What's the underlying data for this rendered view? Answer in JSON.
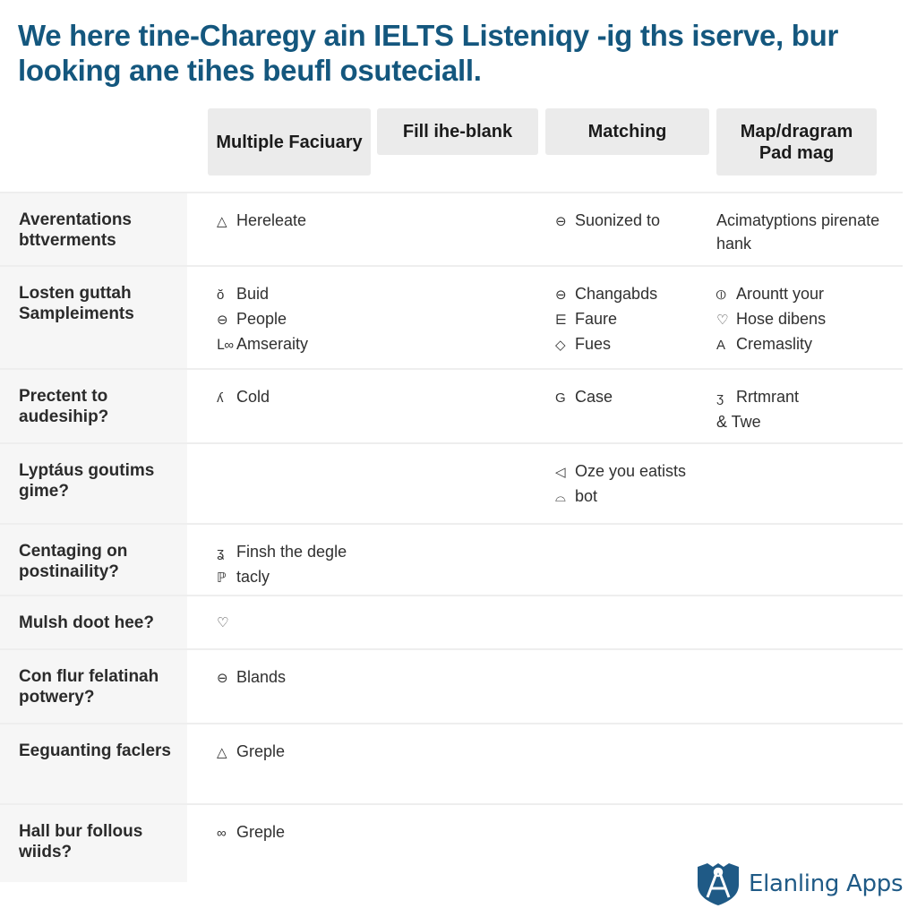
{
  "title": "We here tine-Charegy ain IELTS Listeniqy -ig ths iserve, bur looking ane tihes beufl osuteciall.",
  "columns": [
    "Multiple Faciuary",
    "Fill ihe-blank",
    "Matching",
    "Map/dragram Pad mag"
  ],
  "rows": [
    {
      "label": "Averentations bttverments",
      "cells": [
        [
          {
            "icon": "△",
            "icon_name": "triangle-icon",
            "text": "Hereleate"
          }
        ],
        [
          {
            "icon": "⊖",
            "icon_name": "circle-icon",
            "text": "Suonized to"
          }
        ],
        [
          {
            "icon": "",
            "icon_name": "",
            "text": "Acimatyptions pirenate hank"
          }
        ]
      ]
    },
    {
      "label": "Losten guttah Sampleiments",
      "cells": [
        [
          {
            "icon": "ŏ",
            "icon_name": "glyph-icon",
            "text": "Buid"
          },
          {
            "icon": "⊖",
            "icon_name": "circle-icon",
            "text": "People"
          },
          {
            "icon": "ᒪ∞",
            "icon_name": "loop-icon",
            "text": "Amseraity"
          }
        ],
        [
          {
            "icon": "⊖",
            "icon_name": "circle-icon",
            "text": "Changabds"
          },
          {
            "icon": "⋿",
            "icon_name": "glyph-icon",
            "text": "Faure"
          },
          {
            "icon": "◇",
            "icon_name": "diamond-icon",
            "text": "Fues"
          }
        ],
        [
          {
            "icon": "⦶",
            "icon_name": "circle-icon",
            "text": "Arountt your"
          },
          {
            "icon": "♡",
            "icon_name": "heart-icon",
            "text": "Hose dibens"
          },
          {
            "icon": "A",
            "icon_name": "letter-icon",
            "text": "Cremaslity"
          }
        ]
      ]
    },
    {
      "label": "Prectent to audesihip?",
      "cells": [
        [
          {
            "icon": "ʎ",
            "icon_name": "glyph-icon",
            "text": "Cold"
          }
        ],
        [
          {
            "icon": "G",
            "icon_name": "spiral-icon",
            "text": "Case"
          }
        ],
        [
          {
            "icon": "ʒ",
            "icon_name": "glyph-icon",
            "text": "Rrtmrant"
          },
          {
            "icon": "",
            "icon_name": "",
            "text": "& Twe"
          }
        ]
      ]
    },
    {
      "label": "Lyptáus goutims gime?",
      "cells": [
        [],
        [
          {
            "icon": "◁",
            "icon_name": "flag-icon",
            "text": "Oze you eatists"
          },
          {
            "icon": "⌓",
            "icon_name": "glyph-icon",
            "text": "bot"
          }
        ],
        []
      ]
    },
    {
      "label": "Centaging on postinaility?",
      "cells": [
        [
          {
            "icon": "ʓ",
            "icon_name": "glyph-icon",
            "text": "Finsh the degle"
          },
          {
            "icon": "ℙ",
            "icon_name": "pin-icon",
            "text": "tacly"
          }
        ],
        [],
        []
      ]
    },
    {
      "label": "Mulsh doot hee?",
      "cells": [
        [
          {
            "icon": "♡",
            "icon_name": "heart-icon",
            "text": ""
          }
        ],
        [],
        []
      ]
    },
    {
      "label": "Con flur felatinah potwery?",
      "cells": [
        [
          {
            "icon": "⊖",
            "icon_name": "circle-icon",
            "text": "Blands"
          }
        ],
        [],
        []
      ]
    },
    {
      "label": "Eeguanting faclers",
      "cells": [
        [
          {
            "icon": "△",
            "icon_name": "triangle-icon",
            "text": "Greple"
          }
        ],
        [],
        []
      ]
    },
    {
      "label": "Hall bur follous wiids?",
      "cells": [
        [
          {
            "icon": "∞",
            "icon_name": "loop-icon",
            "text": "Greple"
          }
        ],
        [],
        []
      ]
    }
  ],
  "brand": {
    "name": "Elanling Apps",
    "color": "#1f5a86"
  },
  "colors": {
    "title": "#14577e",
    "header_bg": "#ebebeb",
    "label_bg": "#f6f6f6",
    "divider": "#eeeeee"
  }
}
